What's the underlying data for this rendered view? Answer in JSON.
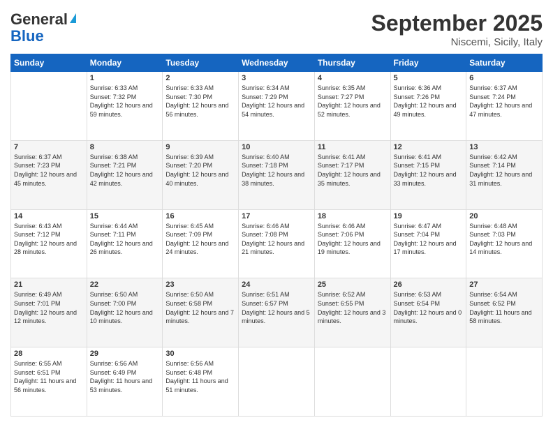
{
  "header": {
    "logo_general": "General",
    "logo_blue": "Blue",
    "month": "September 2025",
    "location": "Niscemi, Sicily, Italy"
  },
  "weekdays": [
    "Sunday",
    "Monday",
    "Tuesday",
    "Wednesday",
    "Thursday",
    "Friday",
    "Saturday"
  ],
  "weeks": [
    [
      {
        "day": "",
        "sunrise": "",
        "sunset": "",
        "daylight": ""
      },
      {
        "day": "1",
        "sunrise": "Sunrise: 6:33 AM",
        "sunset": "Sunset: 7:32 PM",
        "daylight": "Daylight: 12 hours and 59 minutes."
      },
      {
        "day": "2",
        "sunrise": "Sunrise: 6:33 AM",
        "sunset": "Sunset: 7:30 PM",
        "daylight": "Daylight: 12 hours and 56 minutes."
      },
      {
        "day": "3",
        "sunrise": "Sunrise: 6:34 AM",
        "sunset": "Sunset: 7:29 PM",
        "daylight": "Daylight: 12 hours and 54 minutes."
      },
      {
        "day": "4",
        "sunrise": "Sunrise: 6:35 AM",
        "sunset": "Sunset: 7:27 PM",
        "daylight": "Daylight: 12 hours and 52 minutes."
      },
      {
        "day": "5",
        "sunrise": "Sunrise: 6:36 AM",
        "sunset": "Sunset: 7:26 PM",
        "daylight": "Daylight: 12 hours and 49 minutes."
      },
      {
        "day": "6",
        "sunrise": "Sunrise: 6:37 AM",
        "sunset": "Sunset: 7:24 PM",
        "daylight": "Daylight: 12 hours and 47 minutes."
      }
    ],
    [
      {
        "day": "7",
        "sunrise": "Sunrise: 6:37 AM",
        "sunset": "Sunset: 7:23 PM",
        "daylight": "Daylight: 12 hours and 45 minutes."
      },
      {
        "day": "8",
        "sunrise": "Sunrise: 6:38 AM",
        "sunset": "Sunset: 7:21 PM",
        "daylight": "Daylight: 12 hours and 42 minutes."
      },
      {
        "day": "9",
        "sunrise": "Sunrise: 6:39 AM",
        "sunset": "Sunset: 7:20 PM",
        "daylight": "Daylight: 12 hours and 40 minutes."
      },
      {
        "day": "10",
        "sunrise": "Sunrise: 6:40 AM",
        "sunset": "Sunset: 7:18 PM",
        "daylight": "Daylight: 12 hours and 38 minutes."
      },
      {
        "day": "11",
        "sunrise": "Sunrise: 6:41 AM",
        "sunset": "Sunset: 7:17 PM",
        "daylight": "Daylight: 12 hours and 35 minutes."
      },
      {
        "day": "12",
        "sunrise": "Sunrise: 6:41 AM",
        "sunset": "Sunset: 7:15 PM",
        "daylight": "Daylight: 12 hours and 33 minutes."
      },
      {
        "day": "13",
        "sunrise": "Sunrise: 6:42 AM",
        "sunset": "Sunset: 7:14 PM",
        "daylight": "Daylight: 12 hours and 31 minutes."
      }
    ],
    [
      {
        "day": "14",
        "sunrise": "Sunrise: 6:43 AM",
        "sunset": "Sunset: 7:12 PM",
        "daylight": "Daylight: 12 hours and 28 minutes."
      },
      {
        "day": "15",
        "sunrise": "Sunrise: 6:44 AM",
        "sunset": "Sunset: 7:11 PM",
        "daylight": "Daylight: 12 hours and 26 minutes."
      },
      {
        "day": "16",
        "sunrise": "Sunrise: 6:45 AM",
        "sunset": "Sunset: 7:09 PM",
        "daylight": "Daylight: 12 hours and 24 minutes."
      },
      {
        "day": "17",
        "sunrise": "Sunrise: 6:46 AM",
        "sunset": "Sunset: 7:08 PM",
        "daylight": "Daylight: 12 hours and 21 minutes."
      },
      {
        "day": "18",
        "sunrise": "Sunrise: 6:46 AM",
        "sunset": "Sunset: 7:06 PM",
        "daylight": "Daylight: 12 hours and 19 minutes."
      },
      {
        "day": "19",
        "sunrise": "Sunrise: 6:47 AM",
        "sunset": "Sunset: 7:04 PM",
        "daylight": "Daylight: 12 hours and 17 minutes."
      },
      {
        "day": "20",
        "sunrise": "Sunrise: 6:48 AM",
        "sunset": "Sunset: 7:03 PM",
        "daylight": "Daylight: 12 hours and 14 minutes."
      }
    ],
    [
      {
        "day": "21",
        "sunrise": "Sunrise: 6:49 AM",
        "sunset": "Sunset: 7:01 PM",
        "daylight": "Daylight: 12 hours and 12 minutes."
      },
      {
        "day": "22",
        "sunrise": "Sunrise: 6:50 AM",
        "sunset": "Sunset: 7:00 PM",
        "daylight": "Daylight: 12 hours and 10 minutes."
      },
      {
        "day": "23",
        "sunrise": "Sunrise: 6:50 AM",
        "sunset": "Sunset: 6:58 PM",
        "daylight": "Daylight: 12 hours and 7 minutes."
      },
      {
        "day": "24",
        "sunrise": "Sunrise: 6:51 AM",
        "sunset": "Sunset: 6:57 PM",
        "daylight": "Daylight: 12 hours and 5 minutes."
      },
      {
        "day": "25",
        "sunrise": "Sunrise: 6:52 AM",
        "sunset": "Sunset: 6:55 PM",
        "daylight": "Daylight: 12 hours and 3 minutes."
      },
      {
        "day": "26",
        "sunrise": "Sunrise: 6:53 AM",
        "sunset": "Sunset: 6:54 PM",
        "daylight": "Daylight: 12 hours and 0 minutes."
      },
      {
        "day": "27",
        "sunrise": "Sunrise: 6:54 AM",
        "sunset": "Sunset: 6:52 PM",
        "daylight": "Daylight: 11 hours and 58 minutes."
      }
    ],
    [
      {
        "day": "28",
        "sunrise": "Sunrise: 6:55 AM",
        "sunset": "Sunset: 6:51 PM",
        "daylight": "Daylight: 11 hours and 56 minutes."
      },
      {
        "day": "29",
        "sunrise": "Sunrise: 6:56 AM",
        "sunset": "Sunset: 6:49 PM",
        "daylight": "Daylight: 11 hours and 53 minutes."
      },
      {
        "day": "30",
        "sunrise": "Sunrise: 6:56 AM",
        "sunset": "Sunset: 6:48 PM",
        "daylight": "Daylight: 11 hours and 51 minutes."
      },
      {
        "day": "",
        "sunrise": "",
        "sunset": "",
        "daylight": ""
      },
      {
        "day": "",
        "sunrise": "",
        "sunset": "",
        "daylight": ""
      },
      {
        "day": "",
        "sunrise": "",
        "sunset": "",
        "daylight": ""
      },
      {
        "day": "",
        "sunrise": "",
        "sunset": "",
        "daylight": ""
      }
    ]
  ]
}
